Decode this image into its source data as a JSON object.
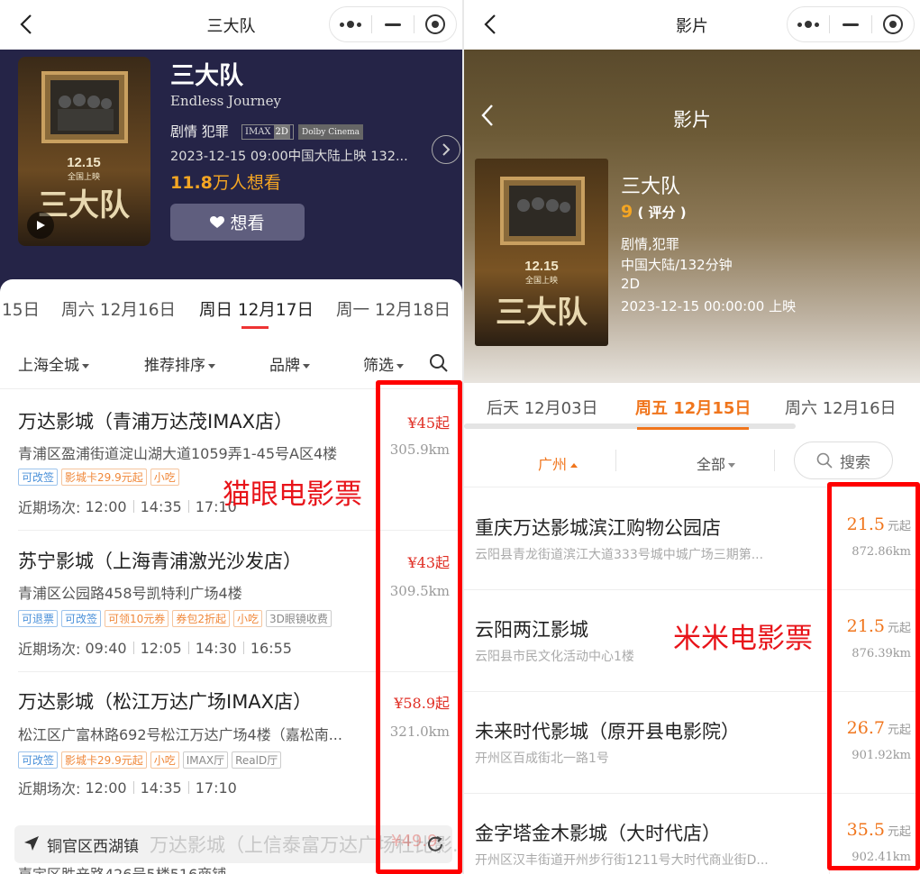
{
  "left": {
    "nav_title": "三大队",
    "movie": {
      "title": "三大队",
      "en_title": "Endless Journey",
      "genre": "剧情 犯罪",
      "format_tags": [
        "IMAX",
        "2D"
      ],
      "dolby_tag": "Dolby Cinema",
      "release": "2023-12-15 09:00中国大陆上映 132...",
      "want_count": "11.8",
      "want_suffix": "万人想看",
      "want_button": "想看",
      "poster_text": [
        "12.15",
        "全国上映",
        "三大队"
      ]
    },
    "date_tabs": [
      "15日",
      "周六 12月16日",
      "周日 12月17日",
      "周一 12月18日"
    ],
    "filters": [
      "上海全城",
      "推荐排序",
      "品牌",
      "筛选"
    ],
    "cinemas": [
      {
        "name": "万达影城（青浦万达茂IMAX店）",
        "address": "青浦区盈浦街道淀山湖大道1059弄1-45号A区4楼",
        "price": "¥45起",
        "distance": "305.9km",
        "tags": [
          {
            "text": "可改签",
            "color": "blue"
          },
          {
            "text": "影城卡29.9元起",
            "color": "orange"
          },
          {
            "text": "小吃",
            "color": "orange"
          }
        ],
        "times_label": "近期场次:",
        "times": [
          "12:00",
          "14:35",
          "17:10"
        ]
      },
      {
        "name": "苏宁影城（上海青浦激光沙发店）",
        "address": "青浦区公园路458号凯特利广场4楼",
        "price": "¥43起",
        "distance": "309.5km",
        "tags": [
          {
            "text": "可退票",
            "color": "blue"
          },
          {
            "text": "可改签",
            "color": "blue"
          },
          {
            "text": "可领10元券",
            "color": "orange"
          },
          {
            "text": "券包2折起",
            "color": "orange"
          },
          {
            "text": "小吃",
            "color": "orange"
          },
          {
            "text": "3D眼镜收费",
            "color": "gray"
          }
        ],
        "times_label": "近期场次:",
        "times": [
          "09:40",
          "12:05",
          "14:30",
          "16:55"
        ]
      },
      {
        "name": "万达影城（松江万达广场IMAX店）",
        "address": "松江区广富林路692号松江万达广场4楼（嘉松南...",
        "price": "¥58.9起",
        "distance": "321.0km",
        "tags": [
          {
            "text": "可改签",
            "color": "blue"
          },
          {
            "text": "影城卡29.9元起",
            "color": "orange"
          },
          {
            "text": "小吃",
            "color": "orange"
          },
          {
            "text": "IMAX厅",
            "color": "gray"
          },
          {
            "text": "RealD厅",
            "color": "gray"
          }
        ],
        "times_label": "近期场次:",
        "times": [
          "12:00",
          "14:35",
          "17:10"
        ]
      }
    ],
    "location_bar": "铜官区西湖镇",
    "partial_row_name": "万达影城（上信泰富万达广场杜比影...",
    "partial_row_price": "¥49.9",
    "partial_row_address": "嘉定区胜辛路426号5楼516商铺",
    "annotation": "猫眼电影票"
  },
  "right": {
    "nav_title": "影片",
    "header_title": "影片",
    "movie": {
      "title": "三大队",
      "score": "9",
      "score_label": "( 评分 )",
      "genre": "剧情,犯罪",
      "region_length": "中国大陆/132分钟",
      "format": "2D",
      "release": "2023-12-15 00:00:00 上映",
      "poster_text": [
        "12.15",
        "全国上映",
        "三大队"
      ]
    },
    "date_tabs": [
      "后天 12月03日",
      "周五 12月15日",
      "周六 12月16日"
    ],
    "filter_city": "广州",
    "filter_all": "全部",
    "search_label": "搜索",
    "price_suffix": "元起",
    "cinemas": [
      {
        "name": "重庆万达影城滨江购物公园店",
        "address": "云阳县青龙街道滨江大道333号城中城广场三期第...",
        "price": "21.5",
        "distance": "872.86km"
      },
      {
        "name": "云阳两江影城",
        "address": "云阳县市民文化活动中心1楼",
        "price": "21.5",
        "distance": "876.39km"
      },
      {
        "name": "未来时代影城（原开县电影院）",
        "address": "开州区百成街北一路1号",
        "price": "26.7",
        "distance": "901.92km"
      },
      {
        "name": "金字塔金木影城（大时代店）",
        "address": "开州区汉丰街道开州步行街1211号大时代商业街D...",
        "price": "35.5",
        "distance": "902.41km"
      }
    ],
    "annotation": "米米电影票"
  },
  "colors": {
    "accent_red": "#e02e24",
    "accent_orange": "#f0751c",
    "header_navy": "#252447",
    "want_gold": "#f5a623",
    "highlight_box": "#ff0000"
  }
}
